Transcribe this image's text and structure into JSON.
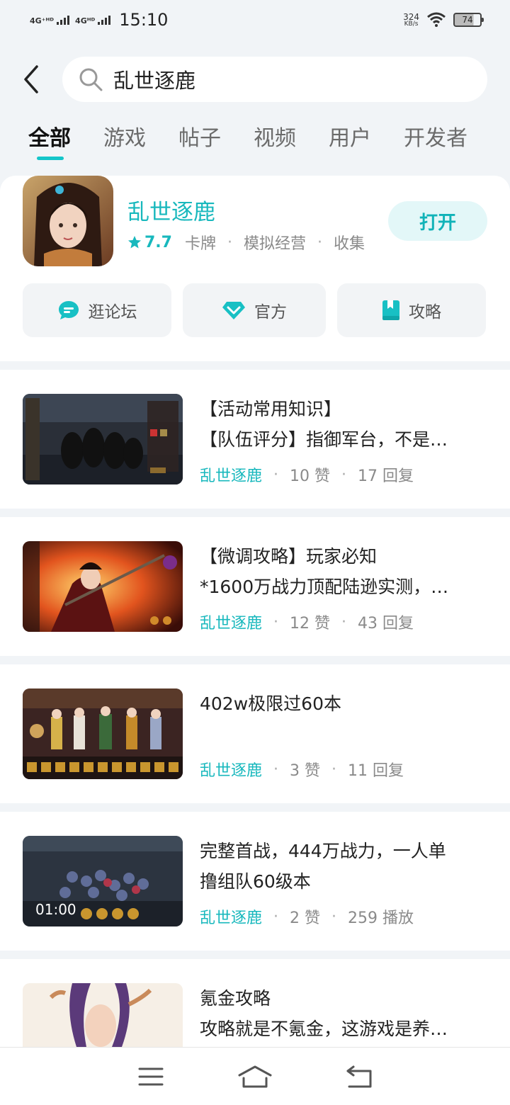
{
  "status_bar": {
    "net1": "4G⁺ᴴᴰ",
    "net2": "4Gᴴᴰ",
    "time": "15:10",
    "speed_value": "324",
    "speed_unit": "KB/s",
    "battery": "74"
  },
  "search": {
    "query": "乱世逐鹿"
  },
  "tabs": [
    {
      "label": "全部",
      "active": true
    },
    {
      "label": "游戏"
    },
    {
      "label": "帖子"
    },
    {
      "label": "视频"
    },
    {
      "label": "用户"
    },
    {
      "label": "开发者"
    }
  ],
  "game": {
    "name": "乱世逐鹿",
    "rating": "7.7",
    "tags": [
      "卡牌",
      "模拟经营",
      "收集"
    ],
    "open_label": "打开",
    "links": [
      "逛论坛",
      "官方",
      "攻略"
    ]
  },
  "posts": [
    {
      "line1": "【活动常用知识】",
      "line2": "【队伍评分】指御军台，不是…",
      "game": "乱世逐鹿",
      "likes": "10 赞",
      "stat": "17 回复"
    },
    {
      "line1": "【微调攻略】玩家必知",
      "line2": "*1600万战力顶配陆逊实测，…",
      "game": "乱世逐鹿",
      "likes": "12 赞",
      "stat": "43 回复"
    },
    {
      "line1": "402w极限过60本",
      "line2": "",
      "game": "乱世逐鹿",
      "likes": "3 赞",
      "stat": "11 回复"
    },
    {
      "line1": "完整首战，444万战力，一人单",
      "line2": "撸组队60级本",
      "game": "乱世逐鹿",
      "likes": "2 赞",
      "stat": "259 播放",
      "duration": "01:00"
    },
    {
      "line1": "氪金攻略",
      "line2": "攻略就是不氪金，这游戏是养…"
    }
  ],
  "colors": {
    "accent": "#14c5c9",
    "background": "#f1f4f7"
  }
}
